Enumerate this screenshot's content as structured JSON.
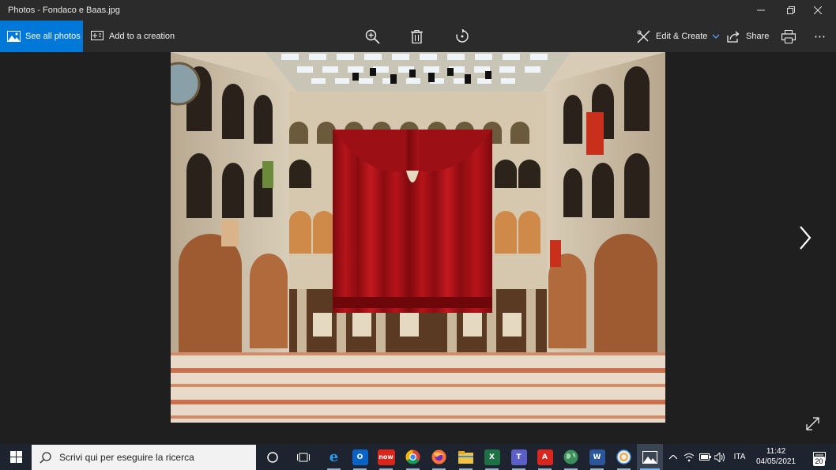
{
  "window": {
    "title": "Photos - Fondaco e Baas.jpg"
  },
  "toolbar": {
    "see_all_label": "See all photos",
    "add_creation_label": "Add to a creation",
    "edit_create_label": "Edit & Create",
    "share_label": "Share",
    "more_label": "⋯",
    "icons": [
      "zoom-in-icon",
      "delete-icon",
      "rotate-icon",
      "edit-create-icon",
      "share-icon",
      "print-icon",
      "more-icon"
    ]
  },
  "colors": {
    "accent": "#0078d7",
    "titlebar": "#2b2b2b",
    "viewer_bg": "#1f1f1f",
    "taskbar": "#1d2430",
    "curtain": "#b5141a"
  },
  "taskbar": {
    "search_placeholder": "Scrivi qui per eseguire la ricerca",
    "apps": [
      {
        "name": "internet-explorer",
        "label": "e"
      },
      {
        "name": "outlook",
        "label": "O"
      },
      {
        "name": "servicenow",
        "label": "now"
      },
      {
        "name": "chrome",
        "label": ""
      },
      {
        "name": "firefox",
        "label": ""
      },
      {
        "name": "file-explorer",
        "label": ""
      },
      {
        "name": "excel",
        "label": "X"
      },
      {
        "name": "teams",
        "label": "T"
      },
      {
        "name": "acrobat",
        "label": "A"
      },
      {
        "name": "maps",
        "label": ""
      },
      {
        "name": "word",
        "label": "W"
      },
      {
        "name": "sync",
        "label": ""
      },
      {
        "name": "photos",
        "label": ""
      }
    ],
    "language": "ITA",
    "time": "11:42",
    "date": "04/05/2021",
    "notification_count": "20"
  }
}
